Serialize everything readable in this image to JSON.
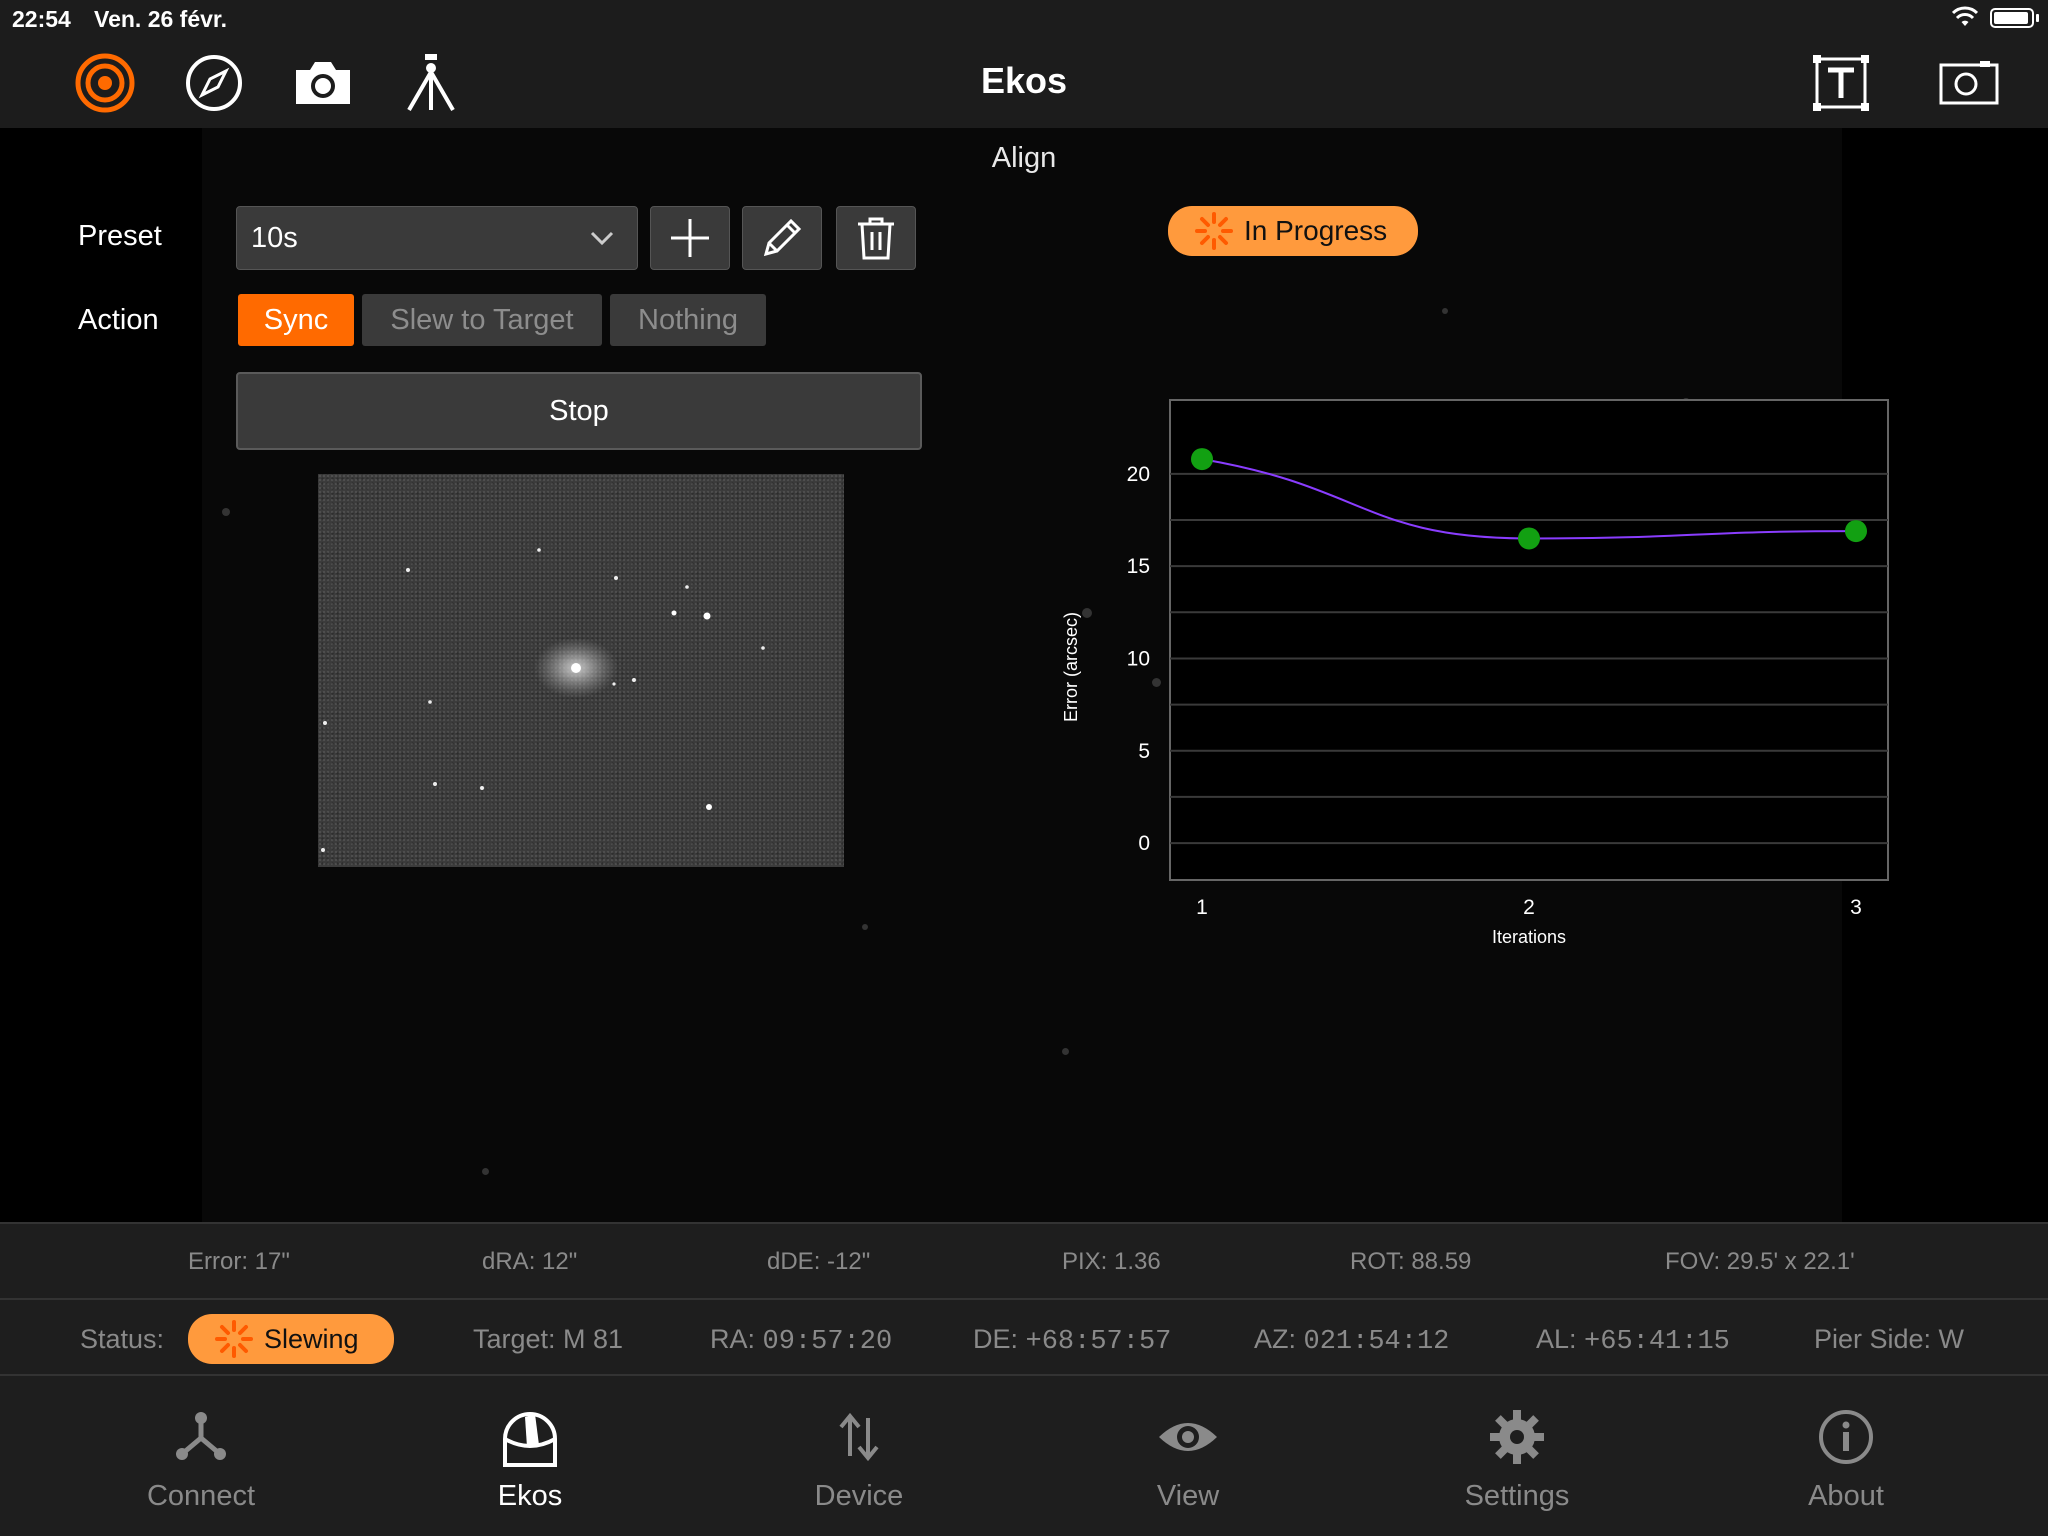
{
  "status_bar": {
    "time": "22:54",
    "date": "Ven. 26 févr."
  },
  "nav": {
    "title": "Ekos",
    "left_icons": [
      "target-icon",
      "compass-icon",
      "camera-icon",
      "tripod-icon"
    ],
    "right_icons": [
      "text-frame-icon",
      "screenshot-icon"
    ]
  },
  "align": {
    "section_title": "Align",
    "preset_label": "Preset",
    "preset_value": "10s",
    "action_label": "Action",
    "actions": [
      "Sync",
      "Slew to Target",
      "Nothing"
    ],
    "active_action": "Sync",
    "stop_label": "Stop",
    "progress_badge": "In Progress"
  },
  "chart_data": {
    "type": "line",
    "x": [
      1,
      2,
      3
    ],
    "y": [
      20.8,
      16.5,
      16.9
    ],
    "xlabel": "Iterations",
    "ylabel": "Error (arcsec)",
    "xticks": [
      "1",
      "2",
      "3"
    ],
    "yticks": [
      "0",
      "5",
      "10",
      "15",
      "20"
    ],
    "ylim": [
      -2,
      24
    ],
    "line_color": "#8a3dff",
    "marker_color": "#12a012"
  },
  "solution": {
    "error": "Error: 17\"",
    "dra": "dRA: 12\"",
    "dde": "dDE: -12\"",
    "pix": "PIX: 1.36",
    "rot": "ROT: 88.59",
    "fov": "FOV: 29.5' x 22.1'"
  },
  "mount": {
    "status_label": "Status:",
    "status_value": "Slewing",
    "target": "Target: M 81",
    "ra_label": "RA:",
    "ra_value": "09:57:20",
    "de_label": "DE:",
    "de_value": "+68:57:57",
    "az_label": "AZ:",
    "az_value": "021:54:12",
    "al_label": "AL:",
    "al_value": "+65:41:15",
    "pier": "Pier Side: W"
  },
  "tabs": [
    {
      "label": "Connect",
      "icon": "connect-icon"
    },
    {
      "label": "Ekos",
      "icon": "dome-icon"
    },
    {
      "label": "Device",
      "icon": "arrows-updown-icon"
    },
    {
      "label": "View",
      "icon": "eye-icon"
    },
    {
      "label": "Settings",
      "icon": "gear-icon"
    },
    {
      "label": "About",
      "icon": "info-icon"
    }
  ],
  "colors": {
    "accent": "#ff6a00",
    "badge": "#ff9a3d",
    "bar": "#1c1c1c"
  }
}
